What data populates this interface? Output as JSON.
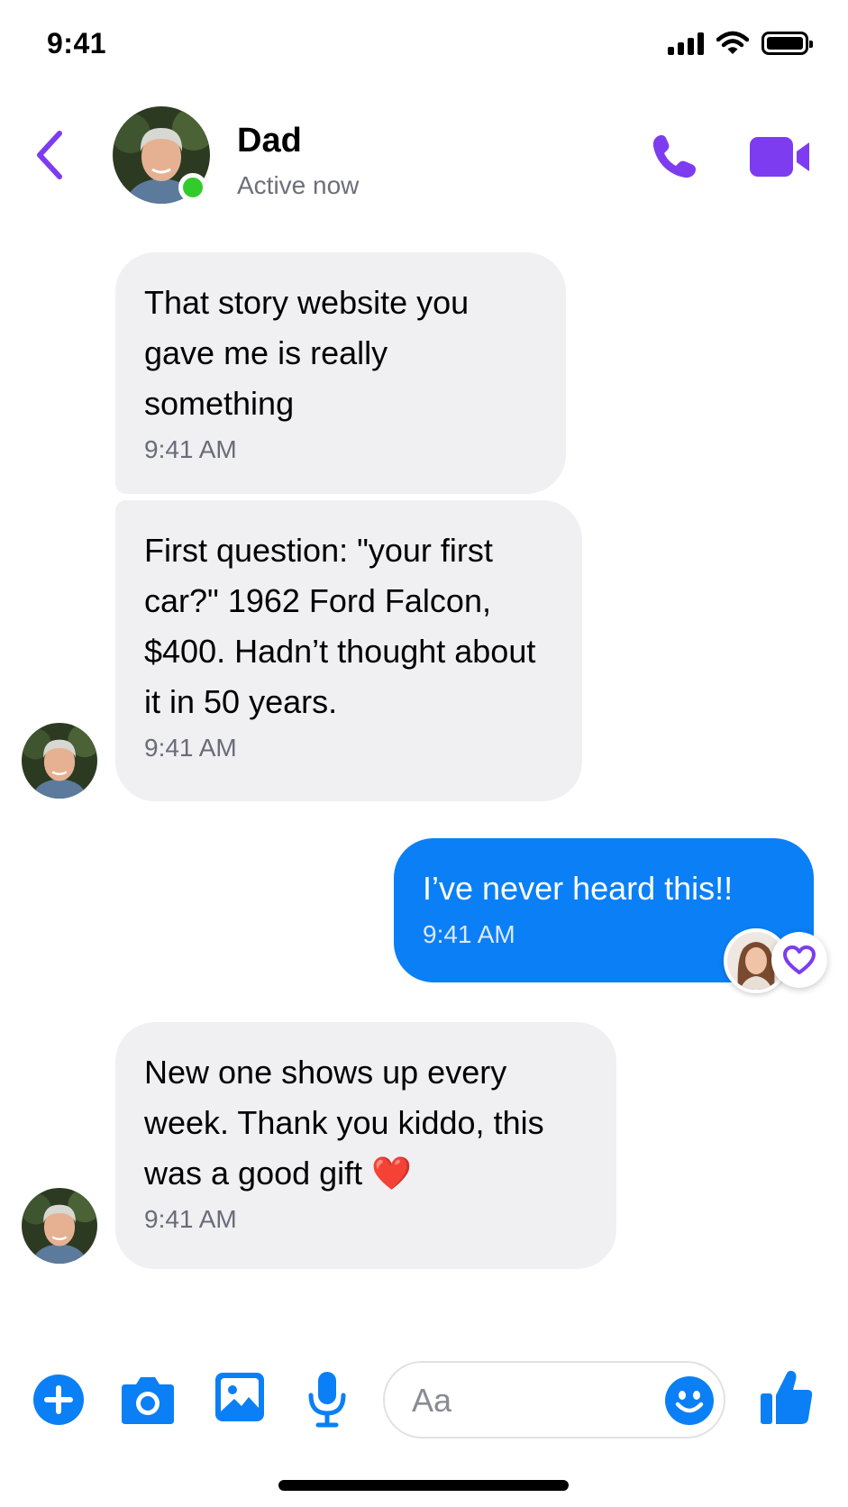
{
  "status_bar": {
    "time": "9:41",
    "icons": [
      "signal-icon",
      "wifi-icon",
      "battery-icon"
    ]
  },
  "header": {
    "back_icon": "chevron-left-icon",
    "contact_name": "Dad",
    "contact_status": "Active now",
    "actions": [
      "phone-icon",
      "video-camera-icon"
    ]
  },
  "messages": [
    {
      "sender": "contact",
      "text": "That story website you gave me is really something",
      "time": "9:41 AM"
    },
    {
      "sender": "contact",
      "text": "First question: \"your first car?\" 1962 Ford Falcon, $400. Hadn’t thought about it in 50 years.",
      "time": "9:41 AM"
    },
    {
      "sender": "me",
      "text": "I’ve never heard this!!",
      "time": "9:41 AM",
      "reaction": "heart-icon"
    },
    {
      "sender": "contact",
      "text": "New one shows up every week. Thank you kiddo, this was a good gift ❤️",
      "time": "9:41 AM"
    }
  ],
  "composer": {
    "placeholder": "Aa",
    "icons": [
      "plus-icon",
      "camera-icon",
      "image-icon",
      "microphone-icon",
      "emoji-icon",
      "thumbs-up-icon"
    ]
  },
  "colors": {
    "accent_purple": "#7d3cf0",
    "accent_blue": "#0b7ff5",
    "online_green": "#31cc2c",
    "incoming_bubble": "#f0f0f2"
  }
}
